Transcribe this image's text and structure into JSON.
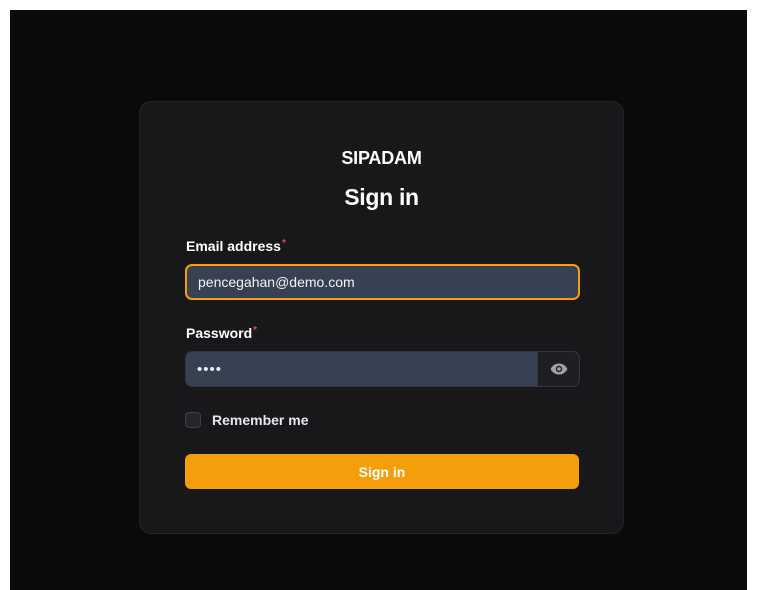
{
  "app": {
    "brand": "SIPADAM",
    "heading": "Sign in"
  },
  "form": {
    "email": {
      "label": "Email address",
      "required_mark": "*",
      "value": "pencegahan@demo.com"
    },
    "password": {
      "label": "Password",
      "required_mark": "*",
      "value": "demo",
      "toggle_icon": "eye-icon"
    },
    "remember": {
      "label": "Remember me",
      "checked": false
    },
    "submit_label": "Sign in"
  },
  "colors": {
    "accent": "#f59e0b",
    "background": "#0a0a0b",
    "card": "#18181b",
    "input": "#374151",
    "required": "#ef4444"
  }
}
